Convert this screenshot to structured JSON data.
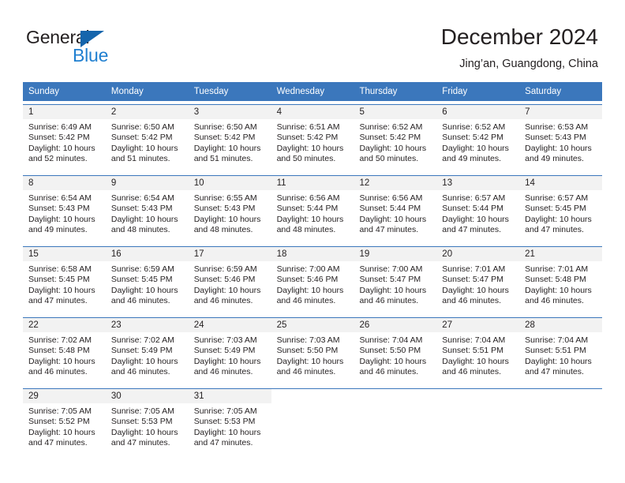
{
  "brand": {
    "name_part1": "General",
    "name_part2": "Blue",
    "accent_color": "#1f7fd0",
    "triangle_color": "#1565ac"
  },
  "header": {
    "title": "December 2024",
    "subtitle": "Jing’an, Guangdong, China"
  },
  "theme": {
    "header_blue": "#3b77bc",
    "daynum_band": "#f2f2f2",
    "text": "#231f20"
  },
  "weekday_headers": [
    "Sunday",
    "Monday",
    "Tuesday",
    "Wednesday",
    "Thursday",
    "Friday",
    "Saturday"
  ],
  "weeks": [
    [
      {
        "day": "1",
        "sunrise": "Sunrise: 6:49 AM",
        "sunset": "Sunset: 5:42 PM",
        "daylight_line1": "Daylight: 10 hours",
        "daylight_line2": "and 52 minutes."
      },
      {
        "day": "2",
        "sunrise": "Sunrise: 6:50 AM",
        "sunset": "Sunset: 5:42 PM",
        "daylight_line1": "Daylight: 10 hours",
        "daylight_line2": "and 51 minutes."
      },
      {
        "day": "3",
        "sunrise": "Sunrise: 6:50 AM",
        "sunset": "Sunset: 5:42 PM",
        "daylight_line1": "Daylight: 10 hours",
        "daylight_line2": "and 51 minutes."
      },
      {
        "day": "4",
        "sunrise": "Sunrise: 6:51 AM",
        "sunset": "Sunset: 5:42 PM",
        "daylight_line1": "Daylight: 10 hours",
        "daylight_line2": "and 50 minutes."
      },
      {
        "day": "5",
        "sunrise": "Sunrise: 6:52 AM",
        "sunset": "Sunset: 5:42 PM",
        "daylight_line1": "Daylight: 10 hours",
        "daylight_line2": "and 50 minutes."
      },
      {
        "day": "6",
        "sunrise": "Sunrise: 6:52 AM",
        "sunset": "Sunset: 5:42 PM",
        "daylight_line1": "Daylight: 10 hours",
        "daylight_line2": "and 49 minutes."
      },
      {
        "day": "7",
        "sunrise": "Sunrise: 6:53 AM",
        "sunset": "Sunset: 5:43 PM",
        "daylight_line1": "Daylight: 10 hours",
        "daylight_line2": "and 49 minutes."
      }
    ],
    [
      {
        "day": "8",
        "sunrise": "Sunrise: 6:54 AM",
        "sunset": "Sunset: 5:43 PM",
        "daylight_line1": "Daylight: 10 hours",
        "daylight_line2": "and 49 minutes."
      },
      {
        "day": "9",
        "sunrise": "Sunrise: 6:54 AM",
        "sunset": "Sunset: 5:43 PM",
        "daylight_line1": "Daylight: 10 hours",
        "daylight_line2": "and 48 minutes."
      },
      {
        "day": "10",
        "sunrise": "Sunrise: 6:55 AM",
        "sunset": "Sunset: 5:43 PM",
        "daylight_line1": "Daylight: 10 hours",
        "daylight_line2": "and 48 minutes."
      },
      {
        "day": "11",
        "sunrise": "Sunrise: 6:56 AM",
        "sunset": "Sunset: 5:44 PM",
        "daylight_line1": "Daylight: 10 hours",
        "daylight_line2": "and 48 minutes."
      },
      {
        "day": "12",
        "sunrise": "Sunrise: 6:56 AM",
        "sunset": "Sunset: 5:44 PM",
        "daylight_line1": "Daylight: 10 hours",
        "daylight_line2": "and 47 minutes."
      },
      {
        "day": "13",
        "sunrise": "Sunrise: 6:57 AM",
        "sunset": "Sunset: 5:44 PM",
        "daylight_line1": "Daylight: 10 hours",
        "daylight_line2": "and 47 minutes."
      },
      {
        "day": "14",
        "sunrise": "Sunrise: 6:57 AM",
        "sunset": "Sunset: 5:45 PM",
        "daylight_line1": "Daylight: 10 hours",
        "daylight_line2": "and 47 minutes."
      }
    ],
    [
      {
        "day": "15",
        "sunrise": "Sunrise: 6:58 AM",
        "sunset": "Sunset: 5:45 PM",
        "daylight_line1": "Daylight: 10 hours",
        "daylight_line2": "and 47 minutes."
      },
      {
        "day": "16",
        "sunrise": "Sunrise: 6:59 AM",
        "sunset": "Sunset: 5:45 PM",
        "daylight_line1": "Daylight: 10 hours",
        "daylight_line2": "and 46 minutes."
      },
      {
        "day": "17",
        "sunrise": "Sunrise: 6:59 AM",
        "sunset": "Sunset: 5:46 PM",
        "daylight_line1": "Daylight: 10 hours",
        "daylight_line2": "and 46 minutes."
      },
      {
        "day": "18",
        "sunrise": "Sunrise: 7:00 AM",
        "sunset": "Sunset: 5:46 PM",
        "daylight_line1": "Daylight: 10 hours",
        "daylight_line2": "and 46 minutes."
      },
      {
        "day": "19",
        "sunrise": "Sunrise: 7:00 AM",
        "sunset": "Sunset: 5:47 PM",
        "daylight_line1": "Daylight: 10 hours",
        "daylight_line2": "and 46 minutes."
      },
      {
        "day": "20",
        "sunrise": "Sunrise: 7:01 AM",
        "sunset": "Sunset: 5:47 PM",
        "daylight_line1": "Daylight: 10 hours",
        "daylight_line2": "and 46 minutes."
      },
      {
        "day": "21",
        "sunrise": "Sunrise: 7:01 AM",
        "sunset": "Sunset: 5:48 PM",
        "daylight_line1": "Daylight: 10 hours",
        "daylight_line2": "and 46 minutes."
      }
    ],
    [
      {
        "day": "22",
        "sunrise": "Sunrise: 7:02 AM",
        "sunset": "Sunset: 5:48 PM",
        "daylight_line1": "Daylight: 10 hours",
        "daylight_line2": "and 46 minutes."
      },
      {
        "day": "23",
        "sunrise": "Sunrise: 7:02 AM",
        "sunset": "Sunset: 5:49 PM",
        "daylight_line1": "Daylight: 10 hours",
        "daylight_line2": "and 46 minutes."
      },
      {
        "day": "24",
        "sunrise": "Sunrise: 7:03 AM",
        "sunset": "Sunset: 5:49 PM",
        "daylight_line1": "Daylight: 10 hours",
        "daylight_line2": "and 46 minutes."
      },
      {
        "day": "25",
        "sunrise": "Sunrise: 7:03 AM",
        "sunset": "Sunset: 5:50 PM",
        "daylight_line1": "Daylight: 10 hours",
        "daylight_line2": "and 46 minutes."
      },
      {
        "day": "26",
        "sunrise": "Sunrise: 7:04 AM",
        "sunset": "Sunset: 5:50 PM",
        "daylight_line1": "Daylight: 10 hours",
        "daylight_line2": "and 46 minutes."
      },
      {
        "day": "27",
        "sunrise": "Sunrise: 7:04 AM",
        "sunset": "Sunset: 5:51 PM",
        "daylight_line1": "Daylight: 10 hours",
        "daylight_line2": "and 46 minutes."
      },
      {
        "day": "28",
        "sunrise": "Sunrise: 7:04 AM",
        "sunset": "Sunset: 5:51 PM",
        "daylight_line1": "Daylight: 10 hours",
        "daylight_line2": "and 47 minutes."
      }
    ],
    [
      {
        "day": "29",
        "sunrise": "Sunrise: 7:05 AM",
        "sunset": "Sunset: 5:52 PM",
        "daylight_line1": "Daylight: 10 hours",
        "daylight_line2": "and 47 minutes."
      },
      {
        "day": "30",
        "sunrise": "Sunrise: 7:05 AM",
        "sunset": "Sunset: 5:53 PM",
        "daylight_line1": "Daylight: 10 hours",
        "daylight_line2": "and 47 minutes."
      },
      {
        "day": "31",
        "sunrise": "Sunrise: 7:05 AM",
        "sunset": "Sunset: 5:53 PM",
        "daylight_line1": "Daylight: 10 hours",
        "daylight_line2": "and 47 minutes."
      },
      {
        "day": "",
        "sunrise": "",
        "sunset": "",
        "daylight_line1": "",
        "daylight_line2": ""
      },
      {
        "day": "",
        "sunrise": "",
        "sunset": "",
        "daylight_line1": "",
        "daylight_line2": ""
      },
      {
        "day": "",
        "sunrise": "",
        "sunset": "",
        "daylight_line1": "",
        "daylight_line2": ""
      },
      {
        "day": "",
        "sunrise": "",
        "sunset": "",
        "daylight_line1": "",
        "daylight_line2": ""
      }
    ]
  ]
}
